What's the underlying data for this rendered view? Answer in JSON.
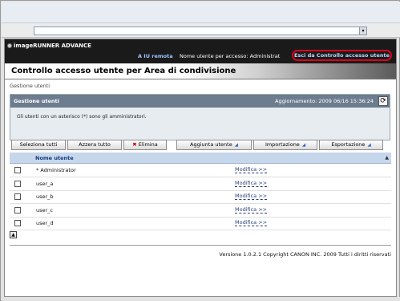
{
  "header": {
    "brand": "imageRUNNER ADVANCE",
    "remote_link": "A IU remota",
    "username_label": "Nome utente per accesso: Administrat",
    "exit_link": "Esci da Controllo accesso utente"
  },
  "page_title": "Controllo accesso utente per Area di condivisione",
  "breadcrumb": "Gestione utenti",
  "panel": {
    "title": "Gestione utenti",
    "updated": "Aggiornamento: 2009 06/16 15:36:24",
    "info": "Gli utenti con un asterisco (*) sono gli amministratori."
  },
  "toolbar": {
    "select_all": "Seleziona tutti",
    "clear_all": "Azzera tutto",
    "delete": "Elimina",
    "add_user": "Aggiunta utente",
    "import": "Importazione",
    "export": "Esportazione"
  },
  "table": {
    "column_header": "Nome utente",
    "rows": [
      {
        "name": "* Administrator",
        "action": "Modifica >>"
      },
      {
        "name": "user_a",
        "action": "Modifica >>"
      },
      {
        "name": "user_b",
        "action": "Modifica >>"
      },
      {
        "name": "user_c",
        "action": "Modifica >>"
      },
      {
        "name": "user_d",
        "action": "Modifica >>"
      }
    ]
  },
  "footer": {
    "copyright": "Versione 1.0.2.1 Copyright CANON INC. 2009 Tutti i diritti riservati"
  },
  "icons": {
    "refresh": "refresh-icon",
    "delete": "x-icon",
    "dropdown": "dropdown-arrow-icon",
    "sort": "sort-icon",
    "back_to_top": "back-to-top-icon"
  },
  "colors": {
    "header_bg": "#1a1a1a",
    "panel_head": "#6d7d8f",
    "table_head": "#c6d7ec",
    "highlight_ring": "#e0001b"
  }
}
